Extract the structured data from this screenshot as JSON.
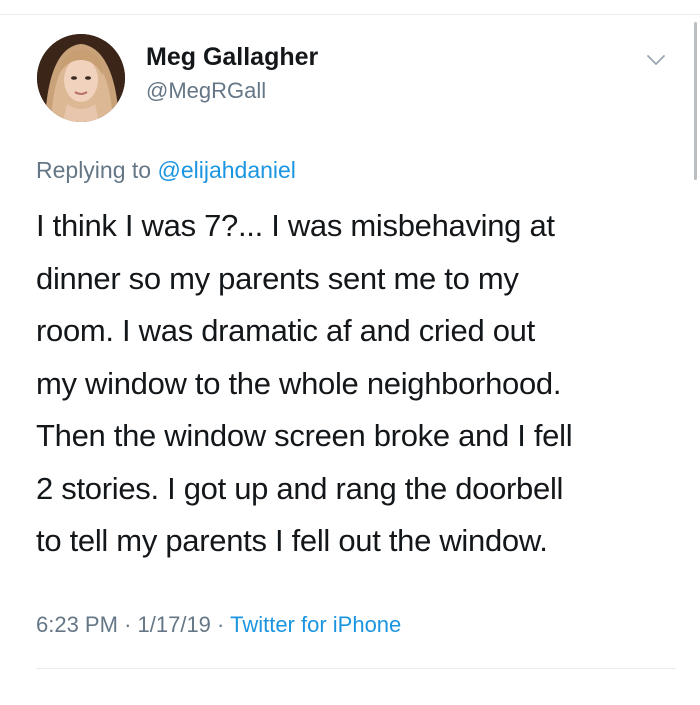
{
  "tweet": {
    "author": {
      "display_name": "Meg Gallagher",
      "handle": "@MegRGall",
      "avatar_icon": "profile-photo"
    },
    "reply_context": {
      "prefix": "Replying to",
      "mention": "@elijahdaniel"
    },
    "text_lines": [
      "I think I was 7?... I was misbehaving at",
      "dinner so my parents sent me to my",
      "room. I was dramatic af and cried out",
      "my window to the whole neighborhood.",
      "Then the window screen broke and I fell",
      "2 stories. I got up and rang the doorbell",
      "to tell my parents I fell out the window."
    ],
    "meta": {
      "time": "6:23 PM",
      "separator": "·",
      "date": "1/17/19",
      "source": "Twitter for iPhone"
    },
    "menu_icon": "chevron-down-icon"
  },
  "colors": {
    "text": "#14171a",
    "secondary": "#657786",
    "link": "#1b95e0",
    "divider": "#e6ecf0"
  }
}
